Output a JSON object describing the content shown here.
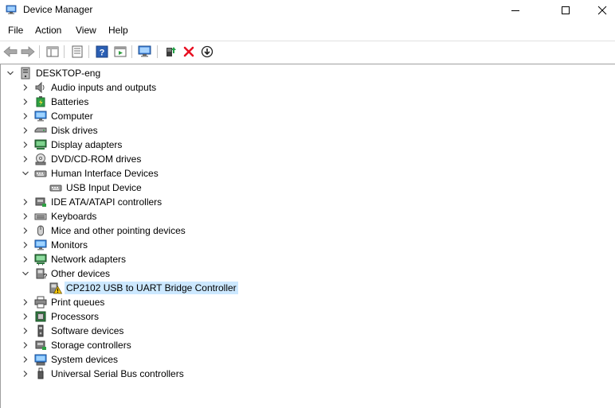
{
  "window": {
    "title": "Device Manager",
    "icon": "device-manager-icon",
    "controls": [
      "minimize-icon",
      "maximize-icon",
      "close-icon"
    ]
  },
  "menu": [
    {
      "label": "File"
    },
    {
      "label": "Action"
    },
    {
      "label": "View"
    },
    {
      "label": "Help"
    }
  ],
  "toolbar": {
    "icons": [
      "back-arrow-icon",
      "forward-arrow-icon",
      "properties-pane-icon",
      "properties-icon",
      "help-icon",
      "show-hidden-icon",
      "scan-hardware-icon",
      "update-driver-icon",
      "uninstall-icon",
      "download-icon"
    ],
    "uninstall_color": "#e81123"
  },
  "tree": {
    "root": {
      "label": "DESKTOP-eng",
      "expanded": true
    },
    "items": [
      {
        "label": "Audio inputs and outputs",
        "icon": "speaker-icon",
        "level": 1,
        "expander": "collapsed"
      },
      {
        "label": "Batteries",
        "icon": "battery-icon",
        "level": 1,
        "expander": "collapsed"
      },
      {
        "label": "Computer",
        "icon": "computer-icon",
        "level": 1,
        "expander": "collapsed"
      },
      {
        "label": "Disk drives",
        "icon": "disk-drive-icon",
        "level": 1,
        "expander": "collapsed"
      },
      {
        "label": "Display adapters",
        "icon": "display-adapter-icon",
        "level": 1,
        "expander": "collapsed"
      },
      {
        "label": "DVD/CD-ROM drives",
        "icon": "dvd-drive-icon",
        "level": 1,
        "expander": "collapsed"
      },
      {
        "label": "Human Interface Devices",
        "icon": "hid-icon",
        "level": 1,
        "expander": "expanded"
      },
      {
        "label": "USB Input Device",
        "icon": "hid-icon",
        "level": 2,
        "expander": "none"
      },
      {
        "label": "IDE ATA/ATAPI controllers",
        "icon": "ide-controller-icon",
        "level": 1,
        "expander": "collapsed"
      },
      {
        "label": "Keyboards",
        "icon": "keyboard-icon",
        "level": 1,
        "expander": "collapsed"
      },
      {
        "label": "Mice and other pointing devices",
        "icon": "mouse-icon",
        "level": 1,
        "expander": "collapsed"
      },
      {
        "label": "Monitors",
        "icon": "monitor-icon",
        "level": 1,
        "expander": "collapsed"
      },
      {
        "label": "Network adapters",
        "icon": "network-adapter-icon",
        "level": 1,
        "expander": "collapsed"
      },
      {
        "label": "Other devices",
        "icon": "other-devices-icon",
        "level": 1,
        "expander": "expanded"
      },
      {
        "label": "CP2102 USB to UART Bridge Controller",
        "icon": "warning-device-icon",
        "level": 2,
        "expander": "none",
        "selected": true
      },
      {
        "label": "Print queues",
        "icon": "printer-icon",
        "level": 1,
        "expander": "collapsed"
      },
      {
        "label": "Processors",
        "icon": "processor-icon",
        "level": 1,
        "expander": "collapsed"
      },
      {
        "label": "Software devices",
        "icon": "software-device-icon",
        "level": 1,
        "expander": "collapsed"
      },
      {
        "label": "Storage controllers",
        "icon": "storage-controller-icon",
        "level": 1,
        "expander": "collapsed"
      },
      {
        "label": "System devices",
        "icon": "system-devices-icon",
        "level": 1,
        "expander": "collapsed"
      },
      {
        "label": "Universal Serial Bus controllers",
        "icon": "usb-icon",
        "level": 1,
        "expander": "collapsed"
      }
    ]
  },
  "colors": {
    "selection": "#cce8ff",
    "warning": "#f5c400"
  }
}
